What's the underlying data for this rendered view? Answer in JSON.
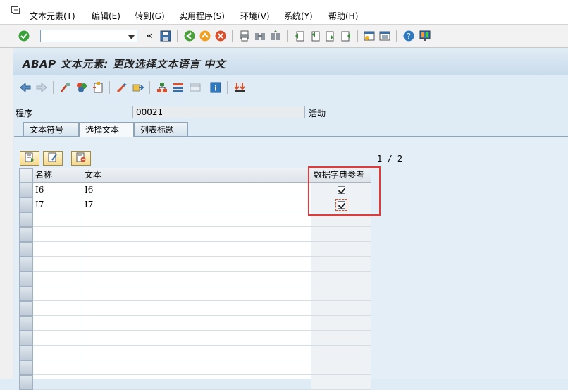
{
  "menu": {
    "items": [
      "文本元素(T)",
      "编辑(E)",
      "转到(G)",
      "实用程序(S)",
      "环境(V)",
      "系统(Y)",
      "帮助(H)"
    ]
  },
  "toolbar": {
    "command_value": ""
  },
  "title": "ABAP 文本元素: 更改选择文本语言 中文",
  "program": {
    "label": "程序",
    "value": "       00021",
    "status": "活动"
  },
  "tabs": [
    "文本符号",
    "选择文本",
    "列表标题"
  ],
  "page_indicator": "1  /  2",
  "table": {
    "headers": [
      "名称",
      "文本",
      "数据字典参考"
    ],
    "rows": [
      {
        "name": "I6",
        "text": "I6",
        "dict_ref": true
      },
      {
        "name": "I7",
        "text": "I7",
        "dict_ref": true
      }
    ]
  },
  "colors": {
    "highlight": "#e03a3a",
    "accent": "#2f79c0"
  }
}
